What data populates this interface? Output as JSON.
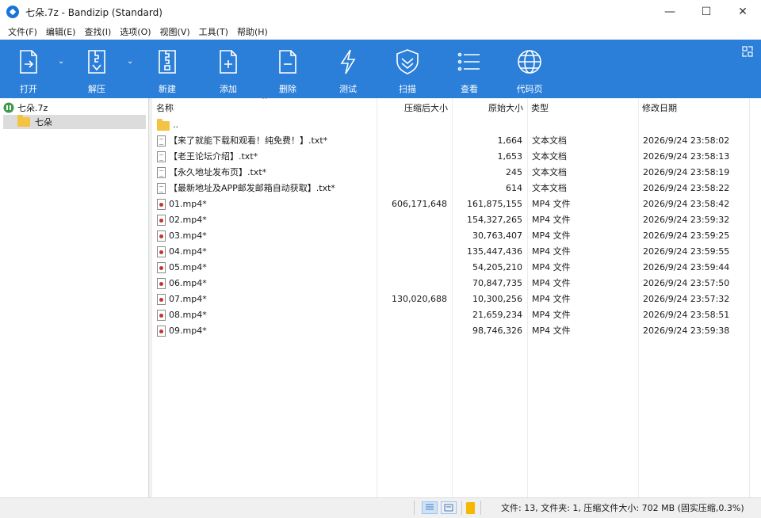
{
  "window": {
    "title": "七朵.7z - Bandizip (Standard)",
    "controls": {
      "minimize": "—",
      "maximize": "☐",
      "close": "✕"
    }
  },
  "menu": [
    "文件(F)",
    "编辑(E)",
    "查找(I)",
    "选项(O)",
    "视图(V)",
    "工具(T)",
    "帮助(H)"
  ],
  "toolbar": {
    "open": "打开",
    "extract": "解压",
    "new": "新建",
    "add": "添加",
    "delete": "删除",
    "test": "测试",
    "scan": "扫描",
    "view": "查看",
    "codepage": "代码页",
    "dropdown_glyph": "⌄"
  },
  "tree": {
    "root": "七朵.7z",
    "child": "七朵"
  },
  "columns": {
    "name": "名称",
    "compressed": "压缩后大小",
    "original": "原始大小",
    "type": "类型",
    "modified": "修改日期",
    "sort_glyph": "^"
  },
  "rows": [
    {
      "icon": "folder",
      "name": "..",
      "compressed": "",
      "original": "",
      "type": "",
      "modified": ""
    },
    {
      "icon": "doc",
      "name": "【来了就能下载和观看！纯免费！】.txt*",
      "compressed": "",
      "original": "1,664",
      "type": "文本文档",
      "modified": "2026/9/24 23:58:02"
    },
    {
      "icon": "doc",
      "name": "【老王论坛介绍】.txt*",
      "compressed": "",
      "original": "1,653",
      "type": "文本文档",
      "modified": "2026/9/24 23:58:13"
    },
    {
      "icon": "doc",
      "name": "【永久地址发布页】.txt*",
      "compressed": "",
      "original": "245",
      "type": "文本文档",
      "modified": "2026/9/24 23:58:19"
    },
    {
      "icon": "doc",
      "name": "【最新地址及APP邮发邮箱自动获取】.txt*",
      "compressed": "",
      "original": "614",
      "type": "文本文档",
      "modified": "2026/9/24 23:58:22"
    },
    {
      "icon": "mp4",
      "name": "01.mp4*",
      "compressed": "606,171,648",
      "original": "161,875,155",
      "type": "MP4 文件",
      "modified": "2026/9/24 23:58:42"
    },
    {
      "icon": "mp4",
      "name": "02.mp4*",
      "compressed": "",
      "original": "154,327,265",
      "type": "MP4 文件",
      "modified": "2026/9/24 23:59:32"
    },
    {
      "icon": "mp4",
      "name": "03.mp4*",
      "compressed": "",
      "original": "30,763,407",
      "type": "MP4 文件",
      "modified": "2026/9/24 23:59:25"
    },
    {
      "icon": "mp4",
      "name": "04.mp4*",
      "compressed": "",
      "original": "135,447,436",
      "type": "MP4 文件",
      "modified": "2026/9/24 23:59:55"
    },
    {
      "icon": "mp4",
      "name": "05.mp4*",
      "compressed": "",
      "original": "54,205,210",
      "type": "MP4 文件",
      "modified": "2026/9/24 23:59:44"
    },
    {
      "icon": "mp4",
      "name": "06.mp4*",
      "compressed": "",
      "original": "70,847,735",
      "type": "MP4 文件",
      "modified": "2026/9/24 23:57:50"
    },
    {
      "icon": "mp4",
      "name": "07.mp4*",
      "compressed": "130,020,688",
      "original": "10,300,256",
      "type": "MP4 文件",
      "modified": "2026/9/24 23:57:32"
    },
    {
      "icon": "mp4",
      "name": "08.mp4*",
      "compressed": "",
      "original": "21,659,234",
      "type": "MP4 文件",
      "modified": "2026/9/24 23:58:51"
    },
    {
      "icon": "mp4",
      "name": "09.mp4*",
      "compressed": "",
      "original": "98,746,326",
      "type": "MP4 文件",
      "modified": "2026/9/24 23:59:38"
    }
  ],
  "status": {
    "summary": "文件: 13, 文件夹: 1, 压缩文件大小: 702 MB (固实压缩,0.3%)"
  },
  "colors": {
    "toolbar_bg": "#2b7fd8",
    "selected_tree": "#dcdcdc"
  }
}
